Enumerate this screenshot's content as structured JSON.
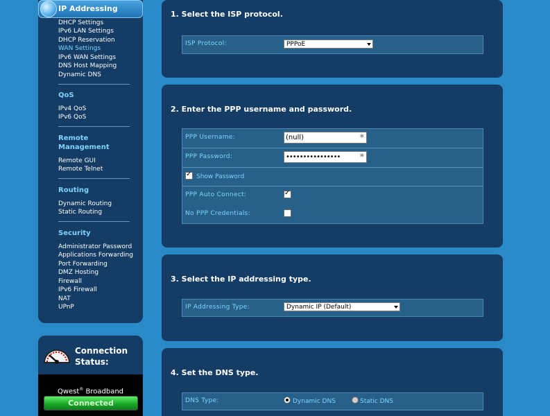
{
  "sidebar": {
    "section_title": "IP Addressing",
    "ip_links": [
      "DHCP Settings",
      "IPv6 LAN Settings",
      "DHCP Reservation",
      "WAN Settings",
      "IPv6 WAN Settings",
      "DNS Host Mapping",
      "Dynamic DNS"
    ],
    "qos": {
      "heading": "QoS",
      "links": [
        "IPv4 QoS",
        "IPv6 QoS"
      ]
    },
    "remote": {
      "heading_line1": "Remote",
      "heading_line2": "Management",
      "links": [
        "Remote GUI",
        "Remote Telnet"
      ]
    },
    "routing": {
      "heading": "Routing",
      "links": [
        "Dynamic Routing",
        "Static Routing"
      ]
    },
    "security": {
      "heading": "Security",
      "links": [
        "Administrator Password",
        "Applications Forwarding",
        "Port Forwarding",
        "DMZ Hosting",
        "Firewall",
        "IPv6 Firewall",
        "NAT",
        "UPnP"
      ]
    }
  },
  "connection": {
    "title_line1": "Connection",
    "title_line2": "Status:",
    "provider": "Qwest",
    "provider_mark": "®",
    "provider_suffix": " Broadband",
    "status": "Connected"
  },
  "step1": {
    "title": "1. Select the ISP protocol.",
    "isp_label": "ISP Protocol:",
    "isp_value": "PPPoE"
  },
  "step2": {
    "title": "2. Enter the PPP username and password.",
    "username_label": "PPP Username:",
    "username_value": "(null)",
    "password_label": "PPP Password:",
    "password_value": "••••••••••••••••",
    "show_password_label": "Show Password",
    "auto_connect_label": "PPP Auto Connect:",
    "no_credentials_label": "No PPP Credentials:"
  },
  "step3": {
    "title": "3. Select the IP addressing type.",
    "type_label": "IP Addressing Type:",
    "type_value": "Dynamic IP (Default)"
  },
  "step4": {
    "title": "4. Set the DNS type.",
    "dns_label": "DNS Type:",
    "dynamic_label": "Dynamic DNS",
    "static_label": "Static DNS"
  },
  "colors": {
    "page_bg": "#2a8ac8",
    "panel_bg": "#143c64",
    "label_cyan": "#7fd4ff",
    "connected_green": "#1aa82a"
  }
}
